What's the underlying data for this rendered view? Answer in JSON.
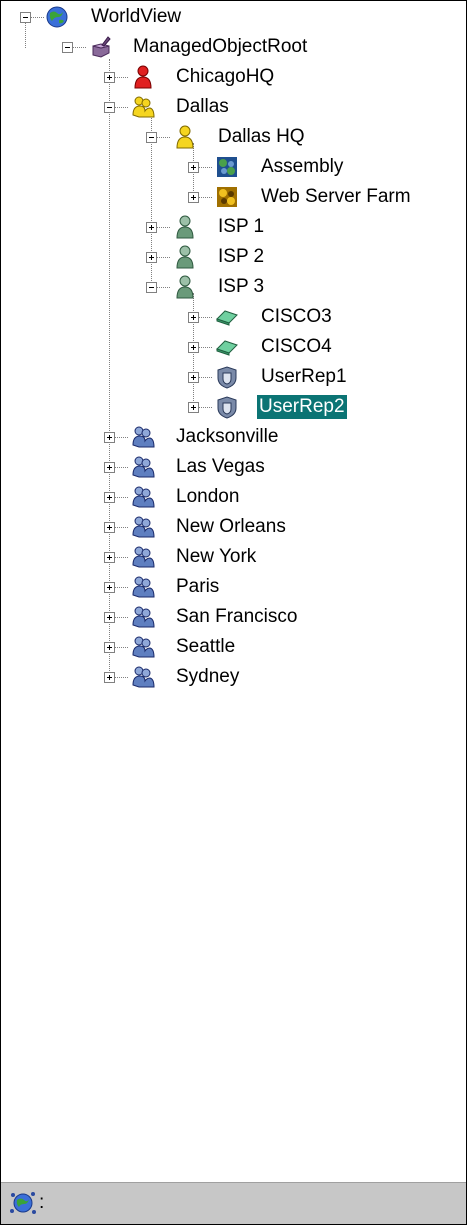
{
  "tree": {
    "root": {
      "label": "WorldView",
      "icon": "globe-icon"
    },
    "managed_root": {
      "label": "ManagedObjectRoot",
      "icon": "managed-object-root-icon"
    },
    "chicago": {
      "label": "ChicagoHQ",
      "icon": "red-person-icon"
    },
    "dallas": {
      "label": "Dallas",
      "icon": "yellow-group-icon"
    },
    "dallas_hq": {
      "label": "Dallas HQ",
      "icon": "yellow-person-icon"
    },
    "assembly": {
      "label": "Assembly",
      "icon": "blue-gear-cluster-icon"
    },
    "web_farm": {
      "label": "Web Server Farm",
      "icon": "yellow-gear-cluster-icon"
    },
    "isp1": {
      "label": "ISP 1",
      "icon": "green-person-icon"
    },
    "isp2": {
      "label": "ISP 2",
      "icon": "green-person-icon"
    },
    "isp3": {
      "label": "ISP 3",
      "icon": "green-person-icon"
    },
    "cisco3": {
      "label": "CISCO3",
      "icon": "router-icon"
    },
    "cisco4": {
      "label": "CISCO4",
      "icon": "router-icon"
    },
    "userrep1": {
      "label": "UserRep1",
      "icon": "shield-icon"
    },
    "userrep2": {
      "label": "UserRep2",
      "icon": "shield-icon",
      "selected": true
    },
    "cities": [
      {
        "label": "Jacksonville"
      },
      {
        "label": "Las Vegas"
      },
      {
        "label": "London"
      },
      {
        "label": "New Orleans"
      },
      {
        "label": "New York"
      },
      {
        "label": "Paris"
      },
      {
        "label": "San Francisco"
      },
      {
        "label": "Seattle"
      },
      {
        "label": "Sydney"
      }
    ]
  },
  "statusbar": {
    "icon": "network-status-icon",
    "text": ":"
  },
  "colors": {
    "selection": "#0b7474",
    "statusbar": "#c7c7c7"
  }
}
